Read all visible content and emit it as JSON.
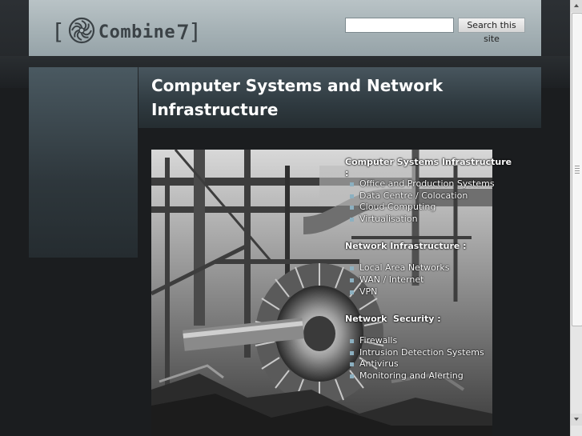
{
  "header": {
    "logo_bracket_left": "[",
    "logo_text": "Combine",
    "logo_bracket_right": "]",
    "logo_icon": "gear-swirl-icon",
    "search_placeholder": "",
    "search_value": "",
    "search_button_label": "Search this site"
  },
  "page": {
    "title": "Computer Systems and Network Infrastructure"
  },
  "content": {
    "sections": [
      {
        "title": "Computer Systems Infrastructure :",
        "items": [
          "Office and Production Systems",
          "Data Centre / Colocation",
          "Cloud Computing",
          "Virtualisation"
        ]
      },
      {
        "title": "Network Infrastructure :",
        "items": [
          "Local Area Networks",
          "WAN / Internet",
          "VPN"
        ]
      },
      {
        "title": "Network  Security :",
        "items": [
          "Firewalls",
          "Intrusion Detection Systems",
          "Antivirus",
          "Monitoring and Alerting"
        ]
      }
    ],
    "bullet_color": "#8cb0c0"
  },
  "colors": {
    "header_bg": "#a5b1b5",
    "page_bg": "#1b1d1f",
    "title_text": "#ffffff"
  }
}
